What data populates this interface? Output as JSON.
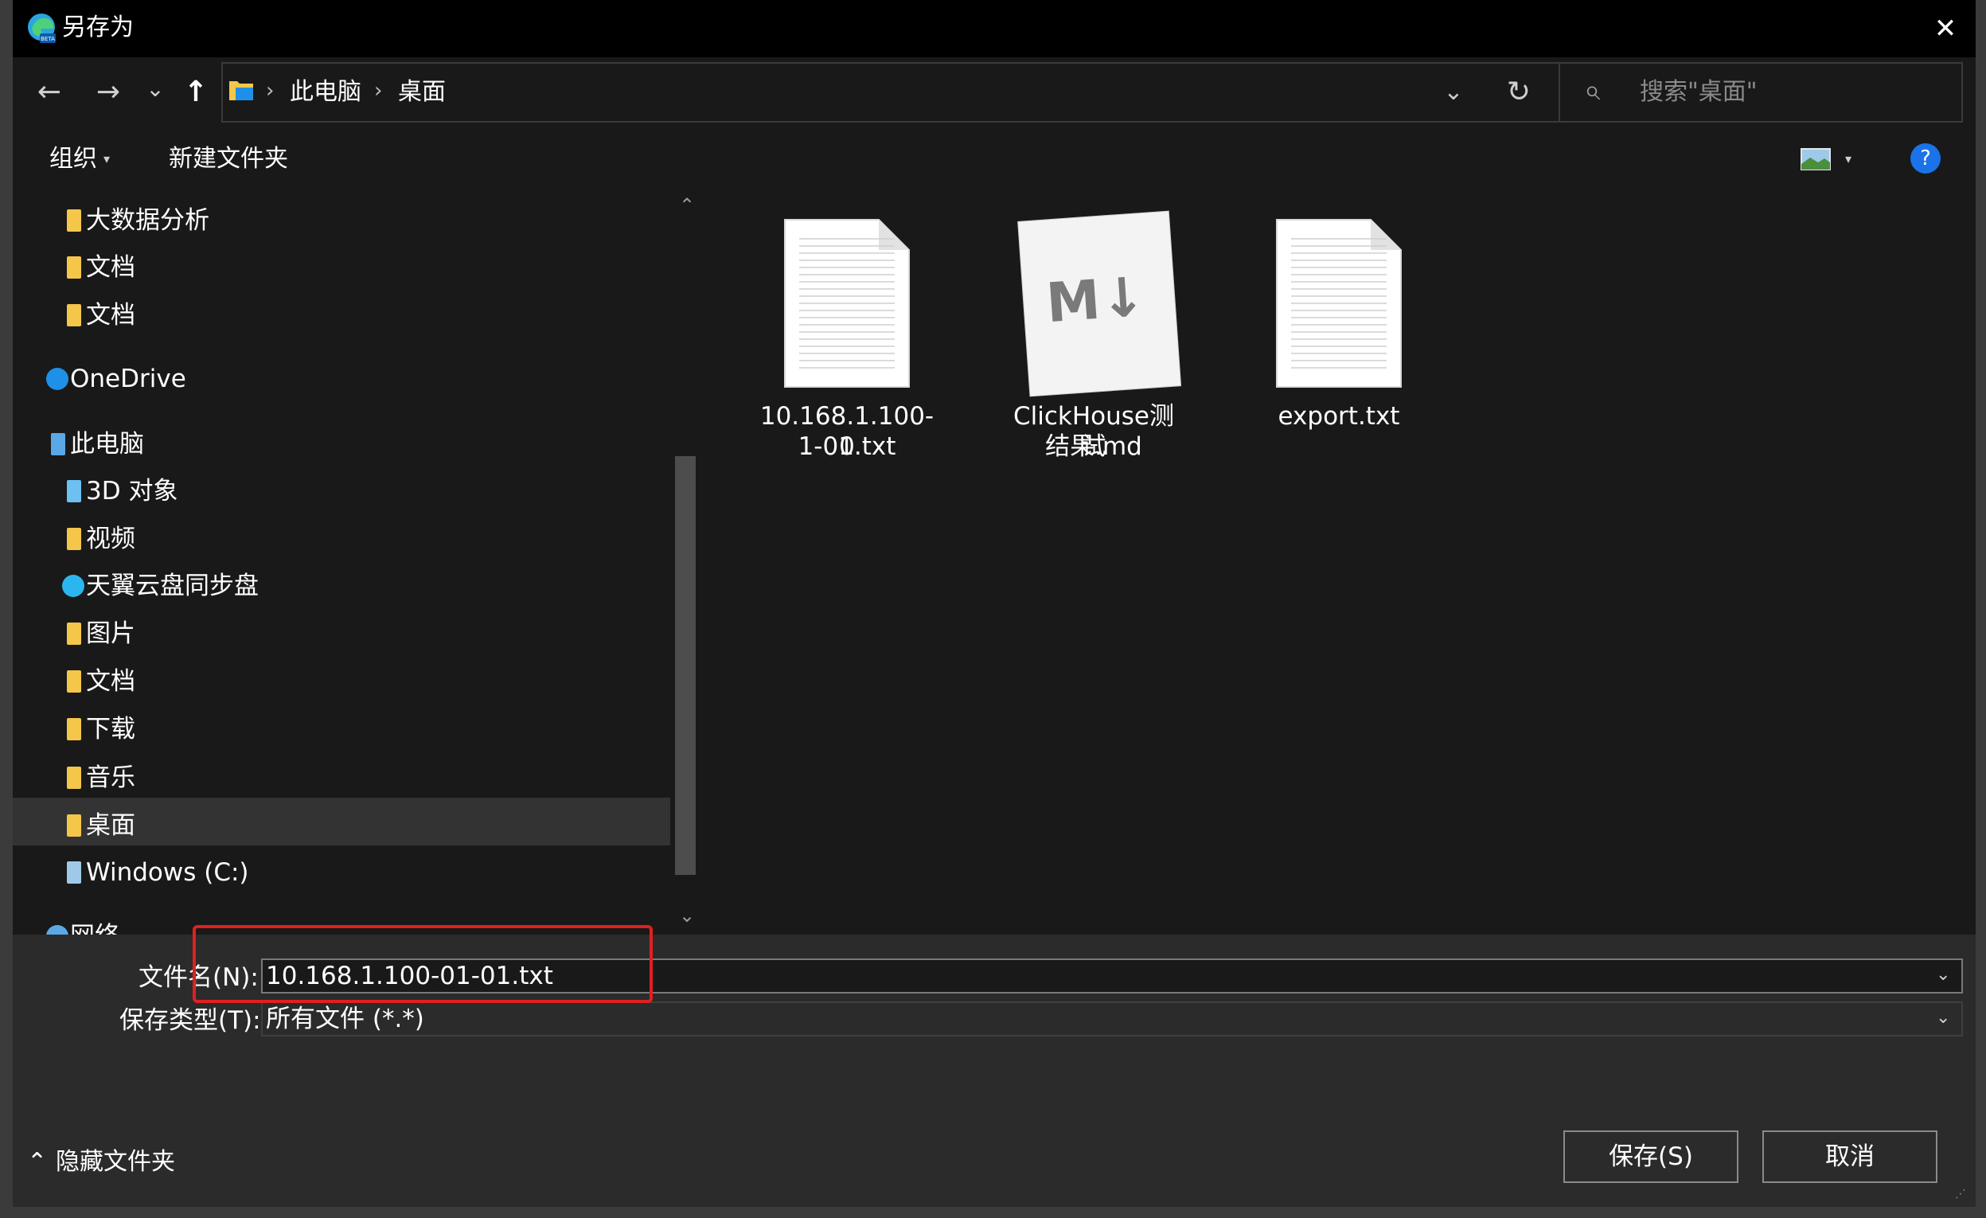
{
  "window": {
    "title": "另存为",
    "app_icon": "edge-beta-icon",
    "close_glyph": "✕"
  },
  "nav": {
    "back_glyph": "←",
    "forward_glyph": "→",
    "recent_glyph": "⌄",
    "up_glyph": "↑",
    "breadcrumb": [
      "此电脑",
      "桌面"
    ],
    "breadcrumb_sep": "›",
    "address_dropdown_glyph": "⌄",
    "refresh_glyph": "↻",
    "search_placeholder": "搜索\"桌面\"",
    "search_glyph": "⌕"
  },
  "toolbar": {
    "organize_label": "组织",
    "organize_arrow": "▾",
    "new_folder_label": "新建文件夹",
    "help_glyph": "?",
    "view_arrow": "▾"
  },
  "sidebar": {
    "items": [
      {
        "label": "大数据分析",
        "icon": "folder-icon"
      },
      {
        "label": "文档",
        "icon": "folder-icon"
      },
      {
        "label": "文档",
        "icon": "folder-icon"
      },
      {
        "label": "OneDrive",
        "icon": "onedrive-icon"
      },
      {
        "label": "此电脑",
        "icon": "computer-icon"
      },
      {
        "label": "3D 对象",
        "icon": "3d-objects-icon"
      },
      {
        "label": "视频",
        "icon": "videos-icon"
      },
      {
        "label": "天翼云盘同步盘",
        "icon": "sync-icon"
      },
      {
        "label": "图片",
        "icon": "pictures-icon"
      },
      {
        "label": "文档",
        "icon": "documents-icon"
      },
      {
        "label": "下载",
        "icon": "downloads-icon"
      },
      {
        "label": "音乐",
        "icon": "music-icon"
      },
      {
        "label": "桌面",
        "icon": "desktop-icon"
      },
      {
        "label": "Windows (C:)",
        "icon": "drive-icon"
      },
      {
        "label": "网络",
        "icon": "network-icon"
      }
    ],
    "selected": "桌面",
    "scroll_up_glyph": "⌃",
    "scroll_down_glyph": "⌄"
  },
  "files": [
    {
      "name_line1": "10.168.1.100-0",
      "name_line2": "1-01.txt",
      "icon": "text-file-icon"
    },
    {
      "name_line1": "ClickHouse测试",
      "name_line2": "结果.md",
      "icon": "markdown-file-icon",
      "badge": "M↓"
    },
    {
      "name_line1": "export.txt",
      "name_line2": "",
      "icon": "text-file-icon"
    }
  ],
  "form": {
    "filename_label": "文件名(N):",
    "filename_value": "10.168.1.100-01-01.txt",
    "filetype_label": "保存类型(T):",
    "filetype_value": "所有文件 (*.*)",
    "dropdown_glyph": "⌄"
  },
  "footer": {
    "hide_folders_glyph": "⌃",
    "hide_folders_label": "隐藏文件夹",
    "save_label": "保存(S)",
    "cancel_label": "取消"
  },
  "colors": {
    "highlight": "#e02020",
    "folder": "#f4c64a",
    "accent": "#1a73e8"
  }
}
